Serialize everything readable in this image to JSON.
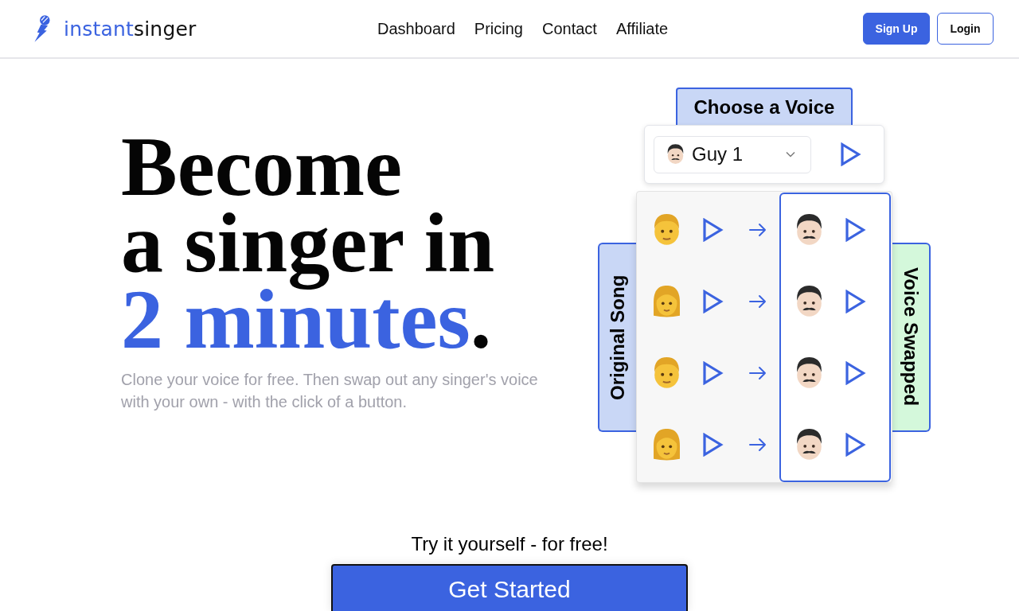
{
  "header": {
    "logo": {
      "highlight": "instant",
      "rest": "singer"
    },
    "nav": [
      "Dashboard",
      "Pricing",
      "Contact",
      "Affiliate"
    ],
    "buttons": [
      {
        "label": "Sign Up",
        "kind": "primary"
      },
      {
        "label": "Login",
        "kind": "outline"
      }
    ]
  },
  "hero": {
    "headline": {
      "lines": [
        "Become",
        "a singer in"
      ],
      "highlight": "2 minutes",
      "ending": "."
    },
    "subtitle": "Clone your voice for free. Then swap out any singer's voice with your own - with the click of a button."
  },
  "demo": {
    "voice_tab": "Choose a Voice",
    "voice_select": {
      "value": "Guy 1"
    },
    "original_tab": "Original Song",
    "swapped_tab": "Voice Swapped",
    "rows": [
      {
        "kind": "man"
      },
      {
        "kind": "woman"
      },
      {
        "kind": "man"
      },
      {
        "kind": "woman"
      }
    ]
  },
  "cta": {
    "prompt": "Try it yourself - for free!",
    "button": "Get Started"
  }
}
